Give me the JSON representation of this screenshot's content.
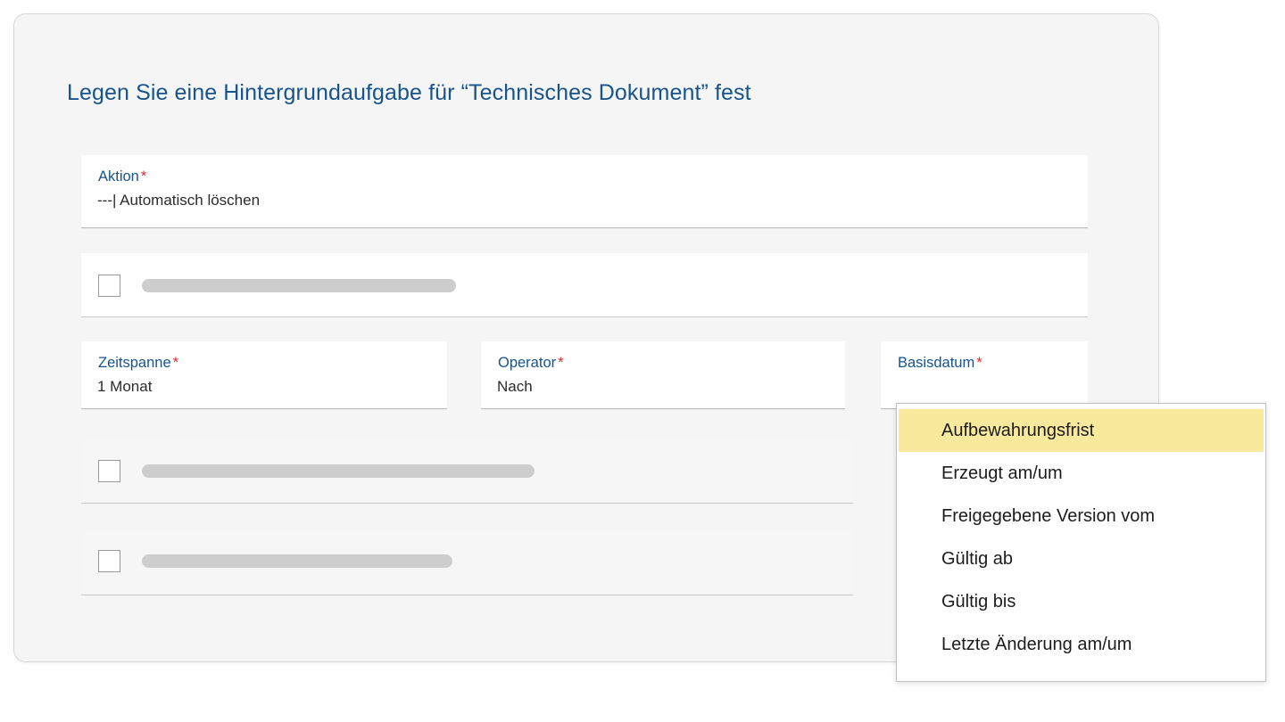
{
  "page": {
    "title": "Legen Sie eine Hintergrundaufgabe für “Technisches Dokument” fest",
    "required_marker": "*",
    "background_color": "#ffffff",
    "card_color": "#f5f5f5",
    "label_color": "#17548e",
    "required_color": "#e02b2b",
    "highlight_color": "#f8e99d"
  },
  "fields": {
    "aktion": {
      "label": "Aktion",
      "required": "*",
      "value": "---| Automatisch löschen"
    },
    "zeitspanne": {
      "label": "Zeitspanne",
      "required": "*",
      "value": "1 Monat"
    },
    "operator": {
      "label": "Operator",
      "required": "*",
      "value": "Nach"
    },
    "basisdatum": {
      "label": "Basisdatum",
      "required": "*",
      "value": ""
    }
  },
  "checkbox_rows": [
    {
      "checked": false,
      "placeholder_width": 352
    },
    {
      "checked": false,
      "placeholder_width": 440
    },
    {
      "checked": false,
      "placeholder_width": 348
    }
  ],
  "dropdown": {
    "open": true,
    "belongs_to": "basisdatum",
    "selected_index": 0,
    "options": [
      "Aufbewahrungsfrist",
      "Erzeugt am/um",
      "Freigegebene Version vom",
      "Gültig ab",
      "Gültig bis",
      "Letzte Änderung am/um"
    ]
  }
}
